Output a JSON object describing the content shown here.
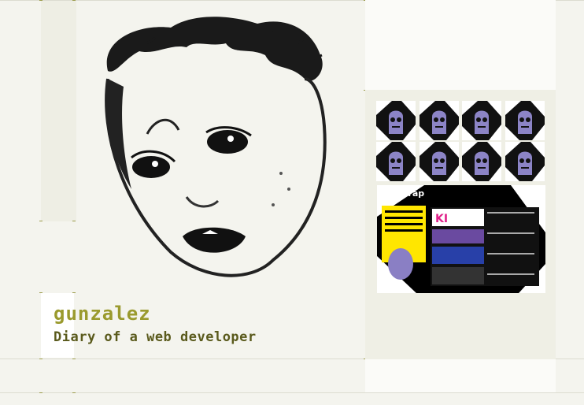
{
  "site": {
    "name": "gunzalez",
    "tagline": "Diary of a web developer"
  },
  "gallery": {
    "thumbs": [
      {
        "label": "avatar-1"
      },
      {
        "label": "avatar-2"
      },
      {
        "label": "avatar-3"
      },
      {
        "label": "avatar-4"
      },
      {
        "label": "avatar-5"
      },
      {
        "label": "avatar-6"
      },
      {
        "label": "avatar-7"
      },
      {
        "label": "avatar-8"
      }
    ],
    "screenshot": {
      "brand": "Firetrap",
      "logo": "KI",
      "items": [
        "KIKA KIKA KIKA >>",
        "FIRETRAP FLAGSHIP STORE NOW OPEN >>",
        "FIRETRAP'S LAUNCH EVENT >>",
        "NEW DEALS >>"
      ]
    }
  },
  "colors": {
    "accent": "#9a9a2e",
    "accent_dark": "#5a5a1c",
    "background": "#f4f4ee"
  }
}
